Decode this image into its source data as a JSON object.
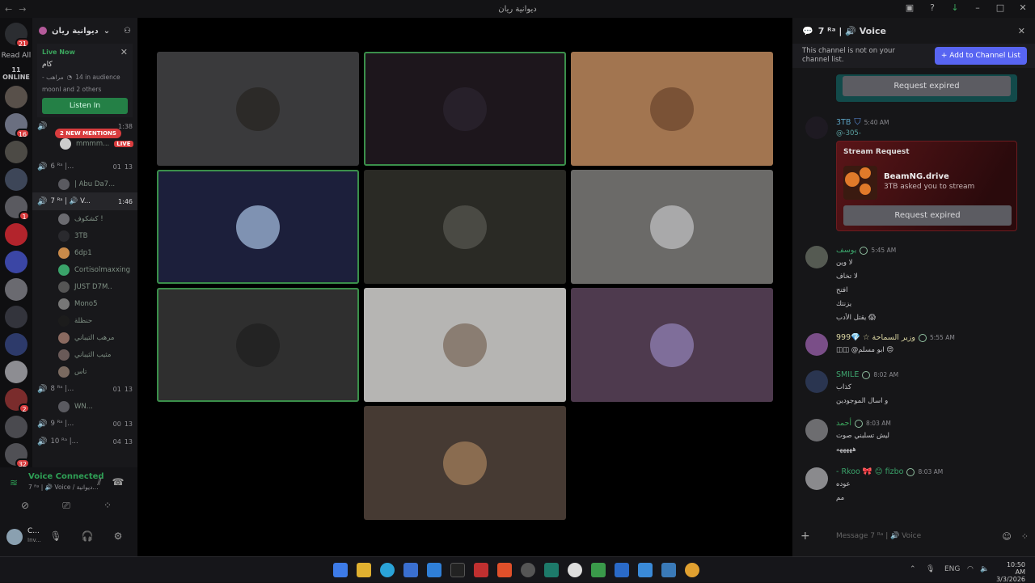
{
  "window": {
    "title": "ديوانية ريان"
  },
  "servers": {
    "top_badge": "21",
    "read_all": "Read All",
    "online": "11 ONLINE",
    "items": [
      {
        "color": "#58504a",
        "badge": ""
      },
      {
        "color": "#6a6f80",
        "badge": "16"
      },
      {
        "color": "#4c4a45",
        "badge": ""
      },
      {
        "color": "#3d4658",
        "badge": ""
      },
      {
        "color": "#5a5a60",
        "badge": "1"
      },
      {
        "color": "#b3242c",
        "badge": ""
      },
      {
        "color": "#3b46a5",
        "badge": ""
      },
      {
        "color": "#6a6a70",
        "badge": ""
      },
      {
        "color": "#33343c",
        "badge": ""
      },
      {
        "color": "#2d3a6a",
        "badge": ""
      },
      {
        "color": "#8d8d92",
        "badge": ""
      },
      {
        "color": "#7a2c2c",
        "badge": "2"
      },
      {
        "color": "#4a4a4f",
        "badge": ""
      },
      {
        "color": "#505055",
        "badge": "32"
      },
      {
        "color": "#5a5550",
        "badge": ""
      }
    ]
  },
  "sidebar": {
    "server_name": "ديوانية ريان",
    "live": {
      "label": "Live Now",
      "channel": "كام",
      "audience": "14 in audience",
      "audience_prefix": "- مراهب",
      "watchers": "moonI and 2 others",
      "listen": "Listen In"
    },
    "mentions": "2 NEW MENTIONS",
    "stream_time": "1:38",
    "live_user": "mmmm...",
    "live_tag": "LIVE",
    "channels": [
      {
        "name": "6 ᴿᵃ |...",
        "c1": "01",
        "c2": "13"
      },
      {
        "name": "7 ᴿᵃ | 🔊 V...",
        "time": "1:46"
      },
      {
        "name": "8 ᴿᵃ |...",
        "c1": "01",
        "c2": "13"
      },
      {
        "name": "9 ᴿᵃ |...",
        "c1": "00",
        "c2": "13"
      },
      {
        "name": "10 ᴿᵃ |...",
        "c1": "04",
        "c2": "13"
      }
    ],
    "member_6": "| Abu Da7...",
    "members_7": [
      "كشكوف !",
      "3TB",
      "6dp1",
      "Cortisolmaxxing",
      "JUST D7M..",
      "Mono5",
      "حنظلة",
      "مرهب التيباني",
      "مثيب الثيباني",
      "تاس"
    ],
    "member_8": "WN..."
  },
  "voice": {
    "status": "Voice Connected",
    "channel": "7 ᴿᵃ | 🔊 Voice / ديوانية...",
    "user": "C...",
    "user_status": "Inv..."
  },
  "tiles": [
    {
      "bg": "#3a3a3c",
      "av": "#2c2a28",
      "speaking": false
    },
    {
      "bg": "#1d161c",
      "av": "#27202a",
      "speaking": true
    },
    {
      "bg": "#a27550",
      "av": "#7a5236",
      "speaking": false
    },
    {
      "bg": "#1c1f3b",
      "av": "#7f92b2",
      "speaking": true
    },
    {
      "bg": "#2a2a25",
      "av": "#4a4a44",
      "speaking": false
    },
    {
      "bg": "#6b6a68",
      "av": "#a9a9aa",
      "speaking": false
    },
    {
      "bg": "#2f2f2f",
      "av": "#232323",
      "speaking": true
    },
    {
      "bg": "#b6b5b3",
      "av": "#8a7d72",
      "speaking": false
    },
    {
      "bg": "#4e3a4e",
      "av": "#7f6e9a",
      "speaking": false
    },
    {
      "bg": "#463a33",
      "av": "#8a6c50",
      "speaking": false
    }
  ],
  "chat": {
    "header": "7 ᴿᵃ | 🔊 Voice",
    "notice": "This channel is not on your channel list.",
    "add_button": "+ Add to Channel List",
    "request_expired": "Request expired",
    "request_expired2": "Request expired",
    "stream": {
      "user": "3TB",
      "time": "5:40 AM",
      "reply": "@-305-",
      "title": "Stream Request",
      "game": "BeamNG.drive",
      "desc": "3TB asked you to stream"
    },
    "messages": [
      {
        "user": "يوسف",
        "time": "5:45 AM",
        "lines": [
          "لا وين",
          "لا تخاف",
          "افتح",
          "يزنتك",
          "يقتل الأدب 😱"
        ],
        "color": "#3aa36a",
        "av": "#555a52"
      },
      {
        "user": "وزير السماحة ☆ 💎999",
        "time": "5:55 AM",
        "lines": [
          "◫◫ @ابو مسلم 😍"
        ],
        "color": "#d8d3a0",
        "av": "#7a4e88"
      },
      {
        "user": "SMILE",
        "time": "8:02 AM",
        "lines": [
          "كذاب",
          "و اسال الموجودين"
        ],
        "color": "#3ea46e",
        "av": "#2a3550"
      },
      {
        "user": "أحمد",
        "time": "8:03 AM",
        "lines": [
          "ليش تسلبني صوت",
          "هههههه"
        ],
        "color": "#3ba55d",
        "av": "#6d6d70"
      },
      {
        "user": "- Rkoo 🎀 😊 fizbo",
        "time": "8:03 AM",
        "lines": [
          "عوده",
          "مم"
        ],
        "color": "#3aa36a",
        "av": "#8a8a8d"
      }
    ],
    "composer_placeholder": "Message 7 ᴿᵃ | 🔊 Voice"
  },
  "taskbar": {
    "lang": "ENG",
    "time": "10:50 AM",
    "date": "3/3/2026"
  }
}
